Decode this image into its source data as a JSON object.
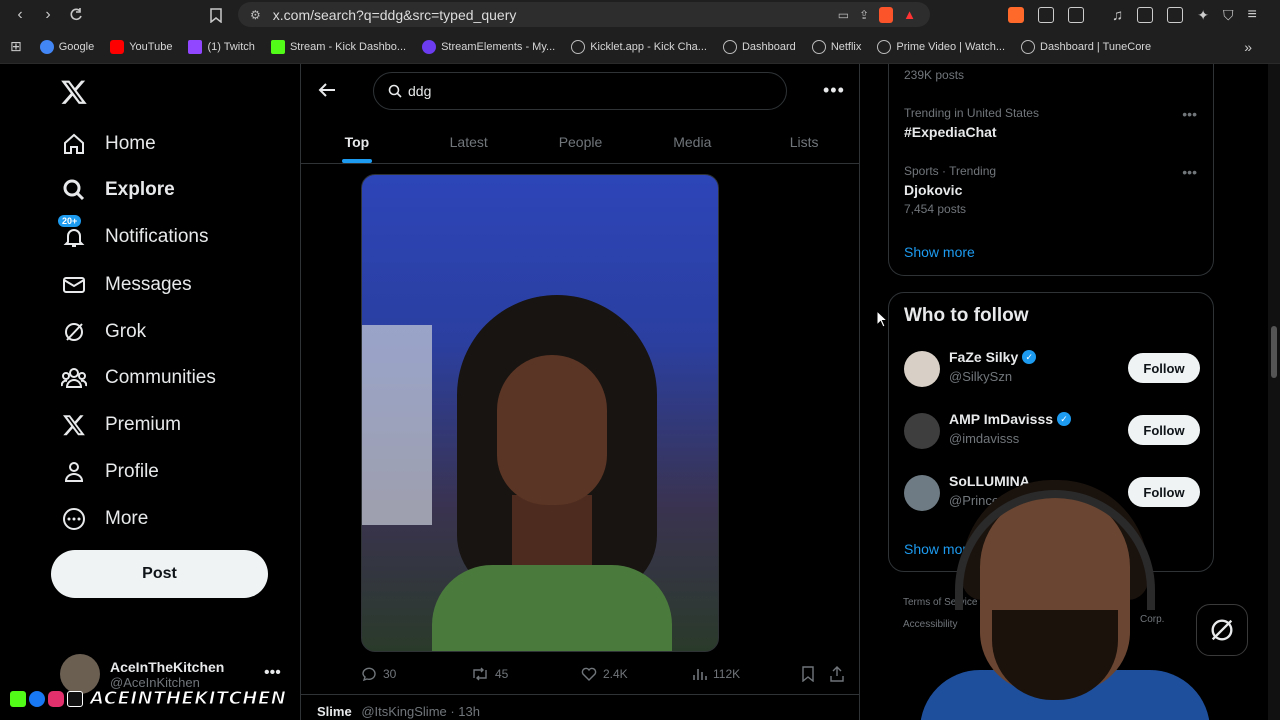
{
  "browser": {
    "url": "x.com/search?q=ddg&src=typed_query",
    "bookmarks": [
      {
        "label": "Google",
        "color": "#4285f4"
      },
      {
        "label": "YouTube",
        "color": "#ff0000"
      },
      {
        "label": "(1) Twitch",
        "color": "#9146ff"
      },
      {
        "label": "Stream - Kick Dashbo...",
        "color": "#53fc18"
      },
      {
        "label": "StreamElements - My...",
        "color": "#6b3cf0"
      },
      {
        "label": "Kicklet.app - Kick Cha...",
        "color": "#888888"
      },
      {
        "label": "Dashboard",
        "color": "#888888"
      },
      {
        "label": "Netflix",
        "color": "#888888"
      },
      {
        "label": "Prime Video | Watch...",
        "color": "#888888"
      },
      {
        "label": "Dashboard | TuneCore",
        "color": "#888888"
      }
    ]
  },
  "nav": {
    "items": [
      {
        "label": "Home",
        "icon": "home-icon"
      },
      {
        "label": "Explore",
        "icon": "search-icon"
      },
      {
        "label": "Notifications",
        "icon": "bell-icon",
        "badge": "20+"
      },
      {
        "label": "Messages",
        "icon": "mail-icon"
      },
      {
        "label": "Grok",
        "icon": "grok-icon"
      },
      {
        "label": "Communities",
        "icon": "communities-icon"
      },
      {
        "label": "Premium",
        "icon": "x-icon"
      },
      {
        "label": "Profile",
        "icon": "person-icon"
      },
      {
        "label": "More",
        "icon": "more-circle-icon"
      }
    ],
    "post_label": "Post",
    "account": {
      "name": "AceInTheKitchen",
      "handle": "@AceInKitchen"
    }
  },
  "search": {
    "query": "ddg",
    "tabs": [
      "Top",
      "Latest",
      "People",
      "Media",
      "Lists"
    ],
    "active_tab": "Top"
  },
  "tweet": {
    "replies": "30",
    "reposts": "45",
    "likes": "2.4K",
    "views": "112K",
    "next_author": "Slime",
    "next_handle": "@ItsKingSlime · 13h"
  },
  "trends": {
    "top_posts": "239K posts",
    "items": [
      {
        "meta": "Trending in United States",
        "name": "#ExpediaChat",
        "posts": ""
      },
      {
        "meta": "Sports · Trending",
        "name": "Djokovic",
        "posts": "7,454 posts"
      }
    ],
    "show_more": "Show more"
  },
  "who_to_follow": {
    "title": "Who to follow",
    "follow_label": "Follow",
    "accounts": [
      {
        "name": "FaZe Silky",
        "handle": "@SilkySzn",
        "avatar_color": "#d8d0c6"
      },
      {
        "name": "AMP ImDavisss",
        "handle": "@imdavisss",
        "avatar_color": "#3e3e3e"
      },
      {
        "name": "SoLLUMINA",
        "handle": "@Prince",
        "avatar_color": "#6e7b84"
      }
    ],
    "show_more": "Show more"
  },
  "footer": {
    "terms": "Terms of Service",
    "accessibility": "Accessibility",
    "corp": "Corp."
  },
  "overlay": {
    "brand": "ACEINTHEKITCHEN"
  },
  "colors": {
    "accent": "#1d9bf0",
    "background": "#000000",
    "border": "#2f3336"
  }
}
